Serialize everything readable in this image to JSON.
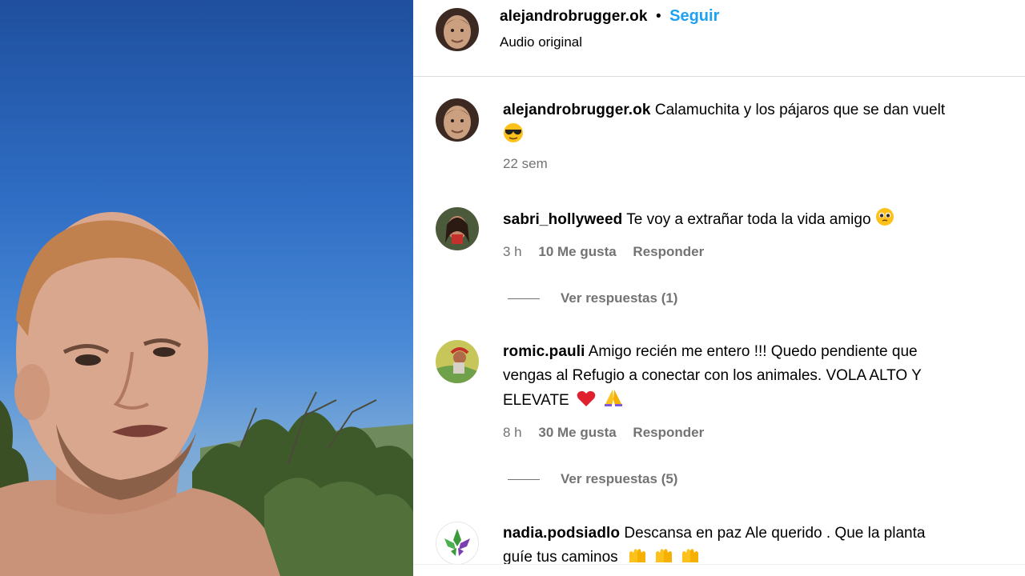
{
  "post": {
    "author": "alejandrobrugger.ok",
    "separator": "•",
    "follow_label": "Seguir",
    "audio": "Audio original"
  },
  "caption": {
    "author": "alejandrobrugger.ok",
    "text": "Calamuchita y los pájaros que se dan vuelt",
    "time": "22 sem"
  },
  "comments": [
    {
      "user": "sabri_hollyweed",
      "text": "Te voy a extrañar toda la vida amigo",
      "time": "3 h",
      "likes": "10 Me gusta",
      "reply_label": "Responder",
      "view_replies": "Ver respuestas (1)"
    },
    {
      "user": "romic.pauli",
      "text_line1": "Amigo recién me entero !!! Quedo pendiente que",
      "text_line2": "vengas al Refugio a conectar con los animales. VOLA ALTO Y",
      "text_line3": "ELEVATE",
      "time": "8 h",
      "likes": "30 Me gusta",
      "reply_label": "Responder",
      "view_replies": "Ver respuestas (5)"
    },
    {
      "user": "nadia.podsiadlo",
      "text_line1": "Descansa en paz Ale querido . Que la planta",
      "text_line2": "guíe tus caminos"
    }
  ],
  "icons": {
    "caption_emoji": "sunglasses-face-icon",
    "comment1_emoji": "pleading-face-icon",
    "comment2_emoji1": "red-heart-icon",
    "comment2_emoji2": "folded-hands-icon",
    "comment3_emoji": "raising-hands-icon"
  },
  "colors": {
    "follow": "#1da1f2",
    "secondary_text": "#737373",
    "divider": "#dbdbdb"
  }
}
